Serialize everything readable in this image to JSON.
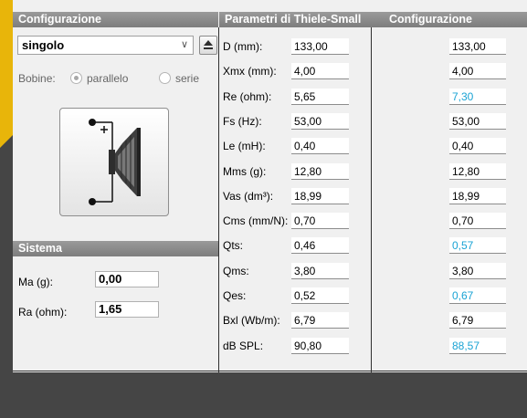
{
  "left_panel": {
    "config_header": "Configurazione",
    "preset_select": "singolo",
    "coil_label": "Bobine:",
    "coil_options": [
      {
        "label": "parallelo",
        "selected": true
      },
      {
        "label": "serie",
        "selected": false
      }
    ],
    "icons": {
      "dropdown": "chevron-down-icon",
      "upload": "upload-icon",
      "speaker": "speaker-icon"
    },
    "system_header": "Sistema",
    "system_fields": [
      {
        "label": "Ma (g):",
        "value": "0,00"
      },
      {
        "label": "Ra (ohm):",
        "value": "1,65"
      }
    ]
  },
  "table": {
    "header_params": "Parametri di Thiele-Small",
    "header_config": "Configurazione",
    "highlight_color": "#1aa3d4",
    "rows": [
      {
        "label": "D (mm):",
        "value": "133,00",
        "config": "133,00",
        "highlight": false
      },
      {
        "label": "Xmx (mm):",
        "value": "4,00",
        "config": "4,00",
        "highlight": false
      },
      {
        "label": "Re (ohm):",
        "value": "5,65",
        "config": "7,30",
        "highlight": true
      },
      {
        "label": "Fs (Hz):",
        "value": "53,00",
        "config": "53,00",
        "highlight": false
      },
      {
        "label": "Le (mH):",
        "value": "0,40",
        "config": "0,40",
        "highlight": false
      },
      {
        "label": "Mms (g):",
        "value": "12,80",
        "config": "12,80",
        "highlight": false
      },
      {
        "label": "Vas (dm³):",
        "value": "18,99",
        "config": "18,99",
        "highlight": false
      },
      {
        "label": "Cms (mm/N):",
        "value": "0,70",
        "config": "0,70",
        "highlight": false
      },
      {
        "label": "Qts:",
        "value": "0,46",
        "config": "0,57",
        "highlight": true
      },
      {
        "label": "Qms:",
        "value": "3,80",
        "config": "3,80",
        "highlight": false
      },
      {
        "label": "Qes:",
        "value": "0,52",
        "config": "0,67",
        "highlight": true
      },
      {
        "label": "Bxl (Wb/m):",
        "value": "6,79",
        "config": "6,79",
        "highlight": false
      },
      {
        "label": "dB SPL:",
        "value": "90,80",
        "config": "88,57",
        "highlight": true
      }
    ]
  }
}
